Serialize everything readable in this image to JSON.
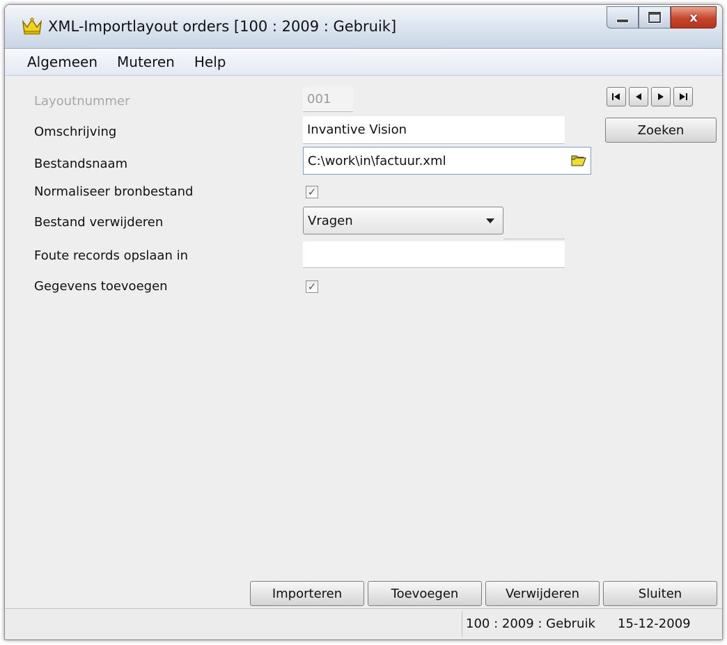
{
  "window": {
    "title": "XML-Importlayout orders  [100 : 2009 : Gebruik]",
    "close_glyph": "x"
  },
  "menu": {
    "items": [
      {
        "label": "Algemeen"
      },
      {
        "label": "Muteren"
      },
      {
        "label": "Help"
      }
    ]
  },
  "form": {
    "layoutnummer": {
      "label": "Layoutnummer",
      "value": "001"
    },
    "omschrijving": {
      "label": "Omschrijving",
      "value": "Invantive Vision"
    },
    "bestandsnaam": {
      "label": "Bestandsnaam",
      "value": "C:\\work\\in\\factuur.xml"
    },
    "normaliseer": {
      "label": "Normaliseer bronbestand",
      "checked": true
    },
    "verwijderen": {
      "label": "Bestand verwijderen",
      "value": "Vragen"
    },
    "foute_records": {
      "label": "Foute records opslaan in",
      "value": ""
    },
    "toevoegen": {
      "label": "Gegevens toevoegen",
      "checked": true
    }
  },
  "navigation": {
    "search_label": "Zoeken",
    "icons": [
      "first-record-icon",
      "previous-record-icon",
      "next-record-icon",
      "last-record-icon"
    ]
  },
  "actions": {
    "importeren": "Importeren",
    "toevoegen": "Toevoegen",
    "verwijderen": "Verwijderen",
    "sluiten": "Sluiten"
  },
  "status": {
    "context": "100 : 2009 : Gebruik",
    "date": "15-12-2009"
  },
  "colors": {
    "window_bg": "#eeeeee",
    "close_button": "#c6452a",
    "folder_icon": "#e8d21c"
  }
}
